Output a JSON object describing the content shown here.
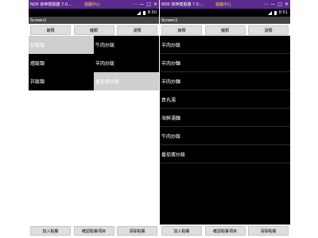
{
  "emulator": {
    "app_label": "NOX 夜神模擬器 7.0....",
    "game_center": "遊戲中心",
    "controls": [
      "⋯",
      "—",
      "□",
      "✕"
    ]
  },
  "left_phone": {
    "status_time": "8:50",
    "screen_title": "Screen1",
    "top_buttons": [
      "飯類",
      "麵類",
      "湯類"
    ],
    "grid": [
      [
        "炒飯類",
        "牛肉炒飯"
      ],
      [
        "燴飯類",
        "羊肉炒飯"
      ],
      [
        "丼飯類",
        "番茄蛋炒飯"
      ]
    ],
    "bottom_buttons": [
      "加入點餐",
      "確認點餐項目",
      "清除點餐"
    ]
  },
  "right_phone": {
    "status_time": "8:51",
    "screen_title": "Screen1",
    "top_buttons": [
      "飯類",
      "麵類",
      "湯類"
    ],
    "list": [
      "羊肉炒飯",
      "羊肉炒麵",
      "羊肉炒麵",
      "貢丸湯",
      "海鮮湯麵",
      "牛肉炒飯",
      "番茄蛋炒飯"
    ],
    "bottom_buttons": [
      "加入點餐",
      "確認點餐項目",
      "清除點餐"
    ]
  },
  "colors": {
    "emulator_bar": "#5c2a8f",
    "title_bar": "#444444",
    "button_bg": "#dedede",
    "selected_cell": "#cfcfcf"
  }
}
